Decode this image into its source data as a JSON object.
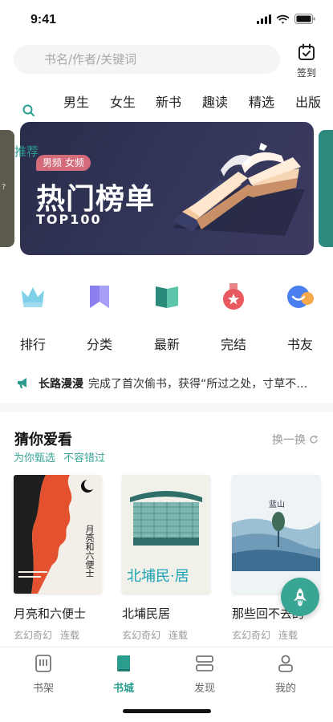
{
  "status": {
    "time": "9:41",
    "icons": [
      "cellular-signal-icon",
      "wifi-icon",
      "battery-icon"
    ]
  },
  "search": {
    "placeholder": "书名/作者/关键词",
    "signin_label": "签到"
  },
  "category_tabs": [
    "男生",
    "女生",
    "新书",
    "趣读",
    "精选",
    "出版"
  ],
  "carousel": {
    "recommend_label": "推荐",
    "banner": {
      "tag": "男频 女频",
      "title": "热门榜单",
      "subtitle": "TOP100"
    },
    "left_card_text": "?"
  },
  "quick_entries": [
    {
      "label": "排行",
      "icon": "crown-icon"
    },
    {
      "label": "分类",
      "icon": "bookmark-icon"
    },
    {
      "label": "最新",
      "icon": "open-book-icon"
    },
    {
      "label": "完结",
      "icon": "medal-icon"
    },
    {
      "label": "书友",
      "icon": "chat-bubble-icon"
    }
  ],
  "notice": {
    "user": "长路漫漫",
    "text": "完成了首次偷书，获得“所过之处，寸草不…"
  },
  "section": {
    "title": "猜你爱看",
    "refresh_label": "换一换",
    "subtags": [
      "为你甄选",
      "不容错过"
    ],
    "books": [
      {
        "title": "月亮和六便士",
        "tags": [
          "玄幻奇幻",
          "连载"
        ],
        "cover_text": "月亮和六便士"
      },
      {
        "title": "北埔民居",
        "tags": [
          "玄幻奇幻",
          "连载"
        ],
        "cover_text": "北埔民·居"
      },
      {
        "title": "那些回不去的",
        "tags": [
          "玄幻奇幻",
          "连载"
        ],
        "cover_text": "蓝山"
      }
    ]
  },
  "tabbar": [
    {
      "label": "书架",
      "icon": "bookshelf-icon",
      "active": false
    },
    {
      "label": "书城",
      "icon": "bookstore-icon",
      "active": true
    },
    {
      "label": "发现",
      "icon": "discover-icon",
      "active": false
    },
    {
      "label": "我的",
      "icon": "profile-icon",
      "active": false
    }
  ],
  "colors": {
    "accent": "#2a9d8f",
    "banner_bg": "#2a2d4a",
    "tag_pink": "#d46b7a"
  }
}
